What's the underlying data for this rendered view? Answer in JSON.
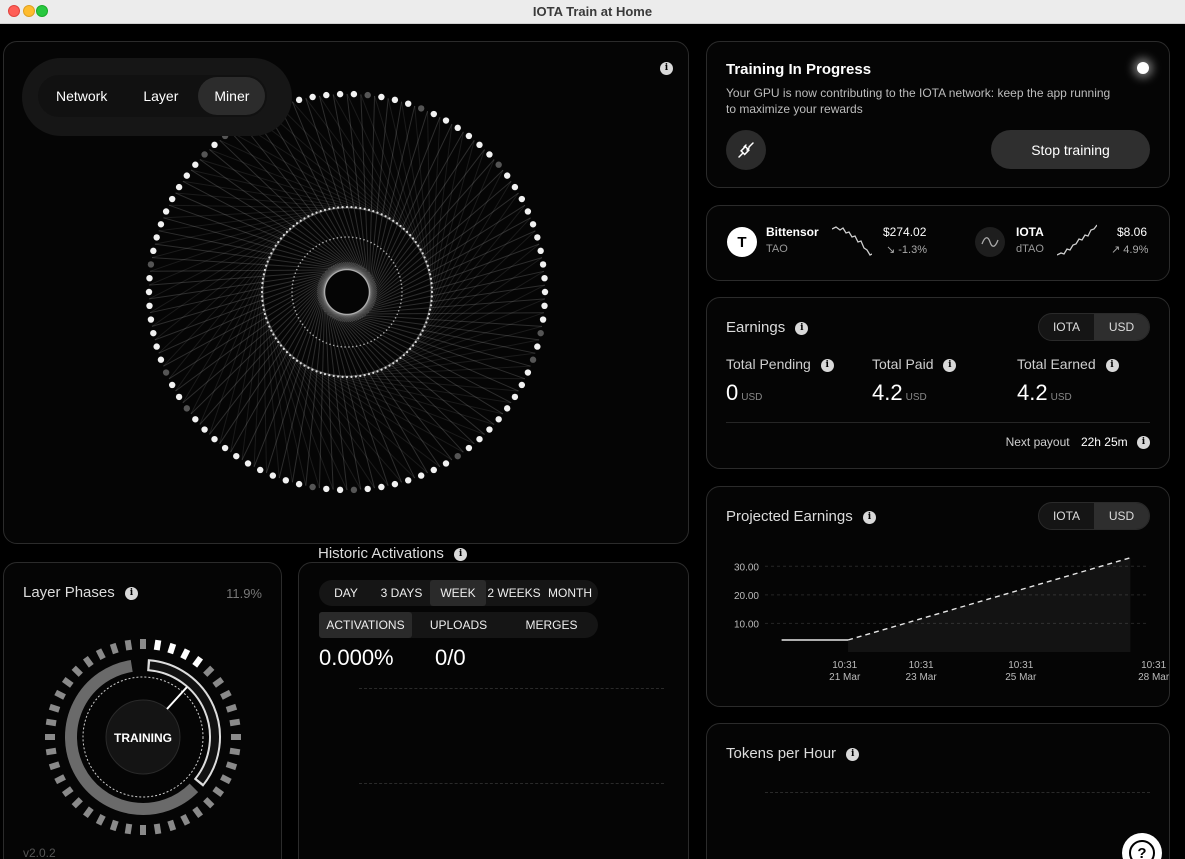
{
  "window": {
    "title": "IOTA Train at Home"
  },
  "view_tabs": [
    {
      "label": "Network"
    },
    {
      "label": "Layer"
    },
    {
      "label": "Miner"
    }
  ],
  "training": {
    "title": "Training In Progress",
    "description_line1": "Your GPU is now contributing to the IOTA network: keep the app running",
    "description_line2": "to maximize your rewards",
    "stop_label": "Stop training"
  },
  "tickers": [
    {
      "name": "Bittensor",
      "symbol": "TAO",
      "price": "$274.02",
      "change": "↘ -1.3%",
      "logo": "T"
    },
    {
      "name": "IOTA",
      "symbol": "dTAO",
      "price": "$8.06",
      "change": "↗ 4.9%",
      "logo": ""
    }
  ],
  "earnings": {
    "title": "Earnings",
    "toggle": [
      "IOTA",
      "USD"
    ],
    "pending_label": "Total Pending",
    "pending_value": "0",
    "paid_label": "Total Paid",
    "paid_value": "4.2",
    "earned_label": "Total Earned",
    "earned_value": "4.2",
    "unit": "USD",
    "next_payout_label": "Next payout",
    "next_payout_value": "22h 25m"
  },
  "projected": {
    "title": "Projected Earnings",
    "toggle": [
      "IOTA",
      "USD"
    ]
  },
  "chart_data": {
    "type": "line",
    "title": "Projected Earnings",
    "xlabel": "",
    "ylabel": "",
    "y_ticks": [
      "30.00",
      "20.00",
      "10.00"
    ],
    "x_ticks": [
      {
        "time": "10:31",
        "date": "21 Mar"
      },
      {
        "time": "10:31",
        "date": "23 Mar"
      },
      {
        "time": "10:31",
        "date": "25 Mar"
      },
      {
        "time": "10:31",
        "date": "28 Mar"
      }
    ],
    "ylim": [
      0,
      35
    ],
    "series": [
      {
        "values": [
          [
            0,
            4.2
          ],
          [
            2,
            4.2
          ]
        ],
        "style": "solid"
      },
      {
        "values": [
          [
            2,
            4.2
          ],
          [
            10.5,
            33
          ]
        ],
        "style": "dashed"
      }
    ],
    "xlim": [
      -0.5,
      11
    ]
  },
  "tokens": {
    "title": "Tokens per Hour"
  },
  "layer_phases": {
    "title": "Layer Phases",
    "percent": "11.9%",
    "center_label": "TRAINING",
    "version": "v2.0.2"
  },
  "historic": {
    "title": "Historic Activations",
    "range_tabs": [
      "DAY",
      "3 DAYS",
      "WEEK",
      "2 WEEKS",
      "MONTH"
    ],
    "type_tabs": [
      "ACTIVATIONS",
      "UPLOADS",
      "MERGES"
    ],
    "rate_value": "0.000%",
    "count_value": "0/0"
  },
  "help": {
    "label": "?"
  },
  "colors": {
    "panel": "#050505",
    "border": "#2b2b2b",
    "accent": "#ffffff"
  }
}
